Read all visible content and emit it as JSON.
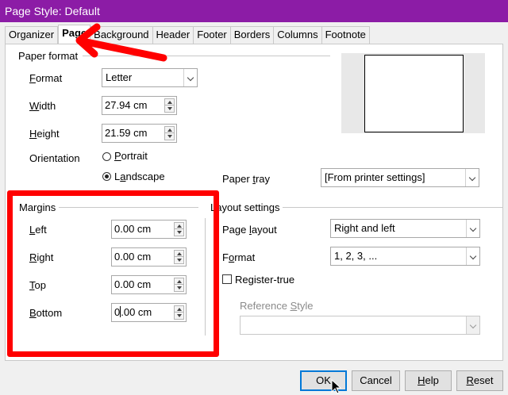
{
  "window": {
    "title": "Page Style: Default"
  },
  "tabs": [
    {
      "label": "Organizer",
      "active": false
    },
    {
      "label": "Page",
      "active": true
    },
    {
      "label": "Background",
      "active": false
    },
    {
      "label": "Header",
      "active": false
    },
    {
      "label": "Footer",
      "active": false
    },
    {
      "label": "Borders",
      "active": false
    },
    {
      "label": "Columns",
      "active": false
    },
    {
      "label": "Footnote",
      "active": false
    }
  ],
  "paper_format": {
    "title": "Paper format",
    "format_label_u": "F",
    "format_label_rest": "ormat",
    "format_value": "Letter",
    "width_label_u": "W",
    "width_label_rest": "idth",
    "width_value": "27.94 cm",
    "height_label_u": "H",
    "height_label_rest": "eight",
    "height_value": "21.59 cm",
    "orientation_label": "Orientation",
    "portrait_u": "P",
    "portrait_rest": "ortrait",
    "landscape_pre": "L",
    "landscape_u": "a",
    "landscape_rest": "ndscape",
    "orientation_selected": "landscape",
    "paper_tray_pre": "Paper ",
    "paper_tray_u": "t",
    "paper_tray_rest": "ray",
    "paper_tray_value": "[From printer settings]"
  },
  "margins": {
    "title": "Margins",
    "left_u": "L",
    "left_rest": "eft",
    "left_value": "0.00 cm",
    "right_u": "R",
    "right_rest": "ight",
    "right_value": "0.00 cm",
    "top_u": "T",
    "top_rest": "op",
    "top_value": "0.00 cm",
    "bottom_u": "B",
    "bottom_rest": "ottom",
    "bottom_value_a": "0",
    "bottom_value_b": ".00 cm"
  },
  "layout_settings": {
    "title": "Layout settings",
    "page_layout_pre": "Page ",
    "page_layout_u": "l",
    "page_layout_rest": "ayout",
    "page_layout_value": "Right and left",
    "format_pre": "F",
    "format_u": "o",
    "format_rest": "rmat",
    "format_value": "1, 2, 3, ...",
    "register_true_label": "Register-true",
    "register_true_checked": false,
    "reference_style_pre": "Reference ",
    "reference_style_u": "S",
    "reference_style_rest": "tyle",
    "reference_style_value": ""
  },
  "buttons": {
    "ok": "OK",
    "cancel": "Cancel",
    "help_u": "H",
    "help_rest": "elp",
    "reset_u": "R",
    "reset_rest": "eset"
  },
  "colors": {
    "title_bar": "#8c1ca6",
    "annotation": "#ff0000",
    "default_button_border": "#0078d7"
  }
}
